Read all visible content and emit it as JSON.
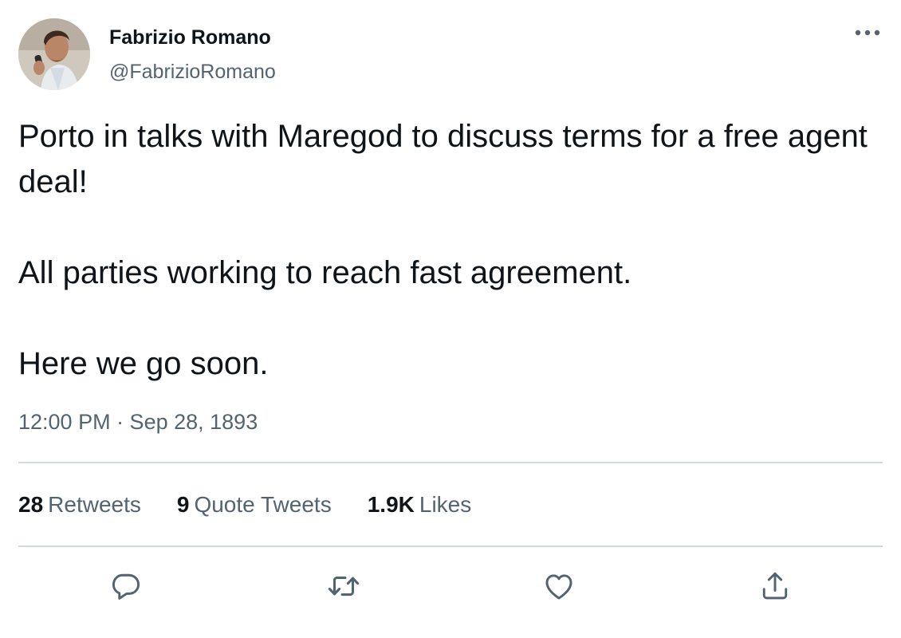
{
  "author": {
    "display_name": "Fabrizio Romano",
    "handle": "@FabrizioRomano",
    "avatar_icon": "user-avatar-photo"
  },
  "tweet": {
    "paragraphs": [
      "Porto in talks with Maregod to discuss terms for a free agent deal!",
      "All parties working to reach fast agreement.",
      "Here we go soon."
    ],
    "timestamp": "12:00 PM · Sep 28, 1893"
  },
  "stats": {
    "retweets": {
      "count": "28",
      "label": "Retweets"
    },
    "quote_tweets": {
      "count": "9",
      "label": "Quote Tweets"
    },
    "likes": {
      "count": "1.9K",
      "label": "Likes"
    }
  },
  "actions": {
    "reply_icon": "reply-icon",
    "retweet_icon": "retweet-icon",
    "like_icon": "heart-icon",
    "share_icon": "share-icon"
  },
  "colors": {
    "text_primary": "#0f1419",
    "text_secondary": "#536471",
    "icon": "#536471",
    "divider": "#cfd9de"
  }
}
